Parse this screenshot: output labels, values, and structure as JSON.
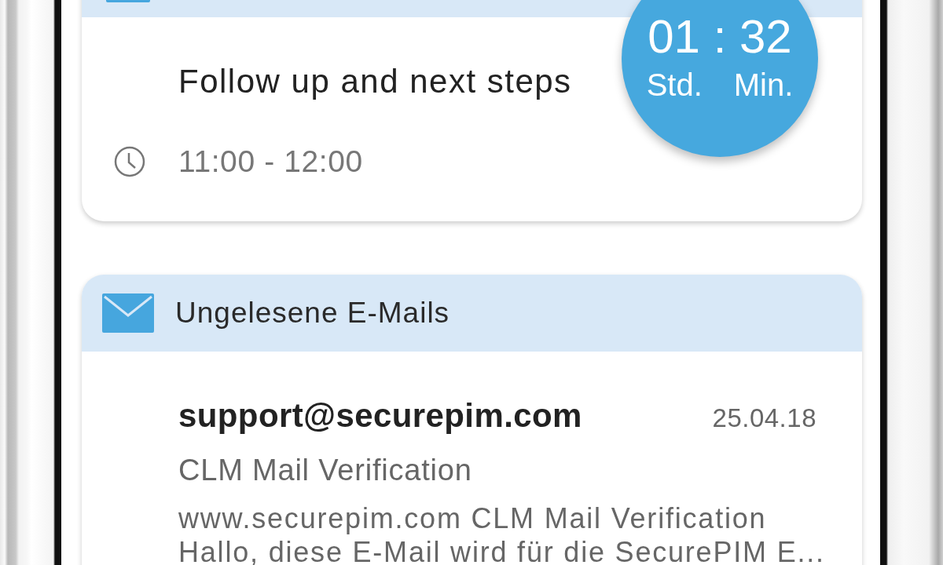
{
  "appointment_card": {
    "title": "Follow up and next steps",
    "time": "11:00 - 12:00"
  },
  "timer": {
    "value": "01 : 32",
    "hours_label": "Std.",
    "minutes_label": "Min."
  },
  "mail_card": {
    "header": "Ungelesene E-Mails",
    "emails": [
      {
        "sender": "support@securepim.com",
        "date": "25.04.18",
        "subject": "CLM Mail Verification",
        "preview": "www.securepim.com CLM Mail Verification Hallo, diese E-Mail wird für die SecurePIM E..."
      }
    ]
  }
}
